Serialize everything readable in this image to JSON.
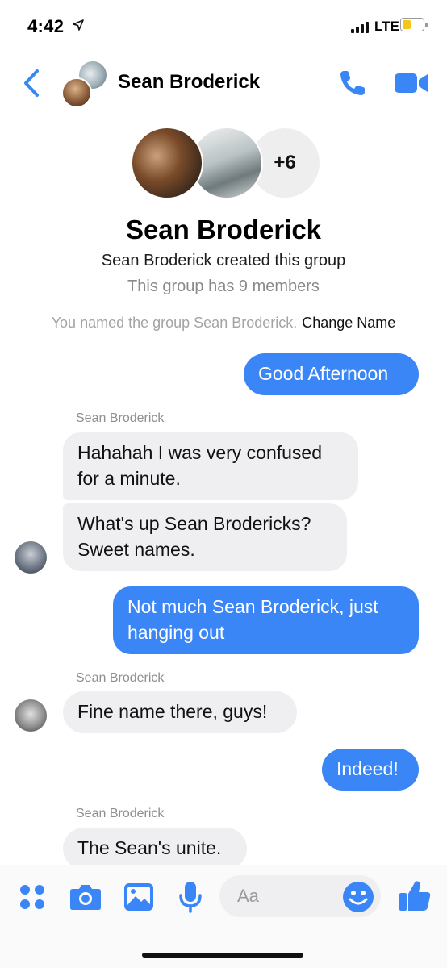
{
  "status_bar": {
    "time": "4:42",
    "network": "LTE",
    "battery_level": 0.3,
    "icons": [
      "location-arrow-icon",
      "signal-icon",
      "battery-icon"
    ]
  },
  "header": {
    "title": "Sean Broderick",
    "icons": [
      "back-chevron-icon",
      "phone-icon",
      "video-camera-icon"
    ],
    "accent_color": "#3a86f6"
  },
  "group_info": {
    "more_count": "+6",
    "name": "Sean Broderick",
    "created_text": "Sean Broderick created this group",
    "members_text": "This group has 9 members",
    "named_text": "You named the group Sean Broderick.",
    "change_name_label": "Change Name"
  },
  "messages": [
    {
      "direction": "out",
      "text": "Good Afternoon"
    },
    {
      "direction": "in",
      "sender": "Sean Broderick",
      "text": "Hahahah I was very confused for a minute."
    },
    {
      "direction": "in",
      "text": "What's up Sean Brodericks? Sweet names."
    },
    {
      "direction": "out",
      "text": "Not much Sean Broderick, just hanging out"
    },
    {
      "direction": "in",
      "sender": "Sean Broderick",
      "text": "Fine name there, guys!"
    },
    {
      "direction": "out",
      "text": "Indeed!"
    },
    {
      "direction": "in",
      "sender": "Sean Broderick",
      "text": "The Sean's unite."
    }
  ],
  "composer": {
    "placeholder": "Aa",
    "icons": [
      "apps-grid-icon",
      "camera-icon",
      "gallery-icon",
      "microphone-icon",
      "emoji-icon",
      "thumbs-up-icon"
    ]
  },
  "colors": {
    "outgoing_bubble": "#3a86f6",
    "incoming_bubble": "#efeff1",
    "accent": "#3a86f6"
  }
}
